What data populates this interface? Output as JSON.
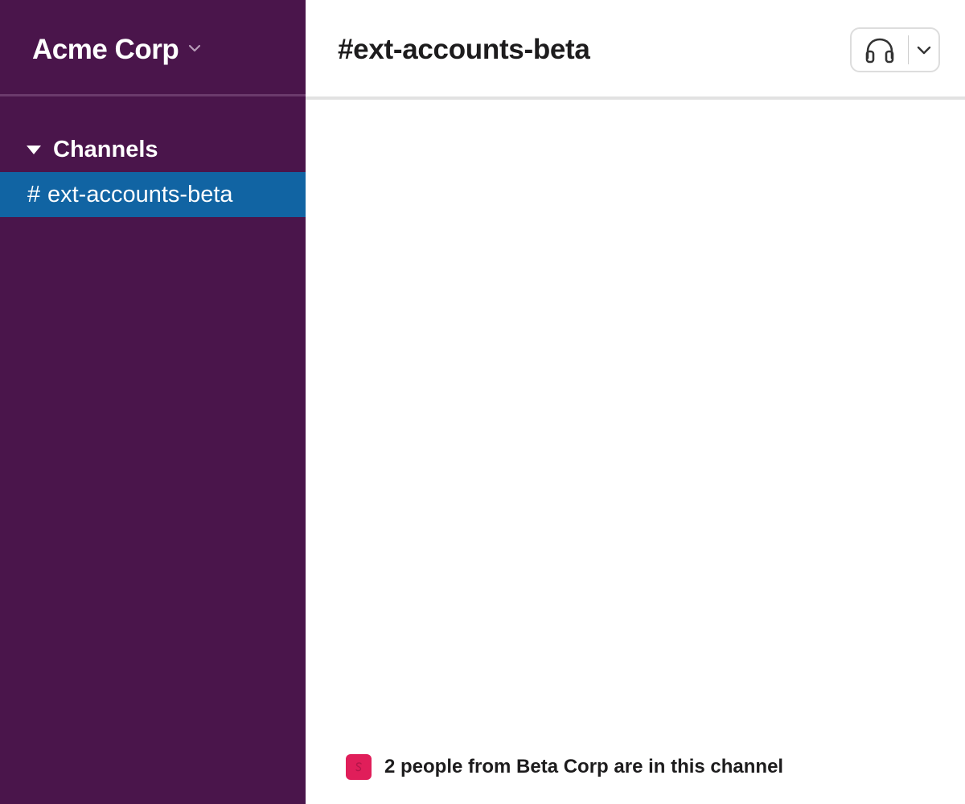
{
  "workspace": {
    "name": "Acme Corp",
    "chevron_icon": "chevron-down-icon"
  },
  "sidebar": {
    "sections": [
      {
        "label": "Channels",
        "caret_icon": "caret-down-icon",
        "items": [
          {
            "prefix": "#",
            "label": "ext-accounts-beta",
            "selected": true
          }
        ]
      }
    ]
  },
  "channel": {
    "title": "#ext-accounts-beta",
    "huddle_icon": "headphones-icon",
    "huddle_menu_icon": "chevron-down-icon"
  },
  "notice": {
    "avatar_icon": "organization-logo-icon",
    "text": "2 people from Beta Corp are in this channel"
  },
  "colors": {
    "sidebar_bg": "#4a154b",
    "selected_channel_bg": "#1164a3",
    "org_avatar": "#e01e5a"
  }
}
